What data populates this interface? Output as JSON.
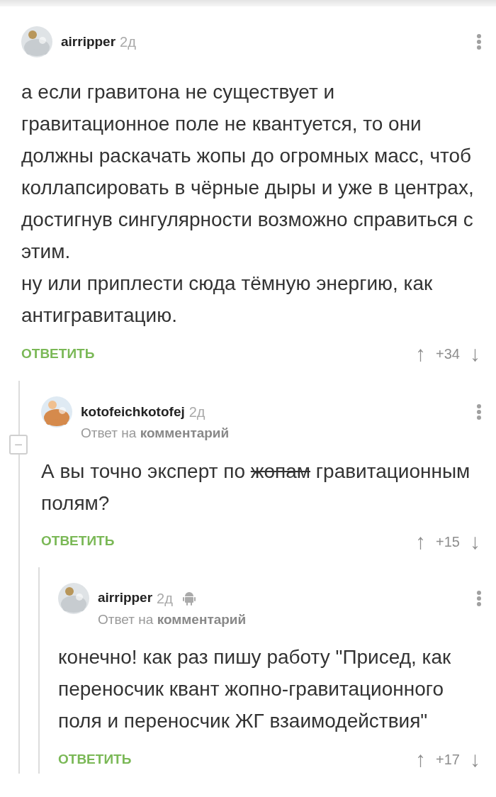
{
  "comments": [
    {
      "author": "airripper",
      "time": "2д",
      "paragraphs": [
        [
          {
            "text": "а если гравитона не существует и гравитационное поле не квантуется, то они должны раскачать жопы до огромных масс, чтоб коллапсировать в чёрные дыры и уже в центрах, достигнув сингулярности возможно справиться с этим."
          }
        ],
        [
          {
            "text": "ну или приплести сюда тёмную энергию, как антигравитацию."
          }
        ]
      ],
      "reply_button": "ОТВЕТИТЬ",
      "up": "↑",
      "score": "+34",
      "down": "↓",
      "children": [
        {
          "author": "kotofeichkotofej",
          "time": "2д",
          "reply_to": "Ответ на **комментарий**",
          "collapse": "−",
          "paragraphs": [
            [
              {
                "text": "А вы точно эксперт по "
              },
              {
                "text": "жопам",
                "struck": true
              },
              {
                "text": " гравитационным полям?"
              }
            ]
          ],
          "reply_button": "ОТВЕТИТЬ",
          "up": "↑",
          "score": "+15",
          "down": "↓",
          "children": [
            {
              "author": "airripper",
              "time": "2д",
              "device_icon": true,
              "reply_to": "Ответ на **комментарий**",
              "paragraphs": [
                [
                  {
                    "text": "конечно! как раз пишу работу \"Присед, как переносчик квант жопно-гравитационного поля и переносчик ЖГ взаимодействия\""
                  }
                ]
              ],
              "reply_button": "ОТВЕТИТЬ",
              "up": "↑",
              "score": "+17",
              "down": "↓"
            }
          ]
        }
      ]
    }
  ]
}
